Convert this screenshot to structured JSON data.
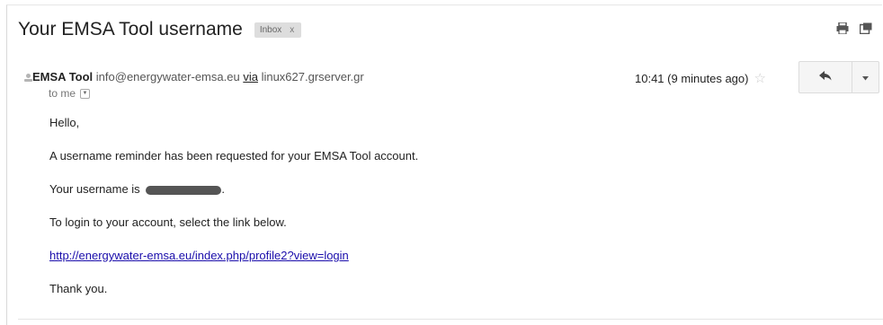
{
  "email": {
    "subject": "Your EMSA Tool username",
    "label": "Inbox",
    "label_close": "x",
    "sender_name": "EMSA Tool",
    "sender_email": "info@energywater-emsa.eu",
    "via_text": "via",
    "via_server": "linux627.grserver.gr",
    "to_text": "to me",
    "time": "10:41 (9 minutes ago)",
    "body": {
      "greeting": "Hello,",
      "line1": "A username reminder has been requested for your EMSA Tool account.",
      "username_prefix": "Your username is",
      "username_suffix": ".",
      "line3": "To login to your account, select the link below.",
      "link": "http://energywater-emsa.eu/index.php/profile2?view=login",
      "closing": "Thank you."
    }
  },
  "icons": {
    "print": "print-icon",
    "new_window": "new-window-icon",
    "avatar": "avatar-icon",
    "star": "star-icon",
    "reply": "reply-icon",
    "more": "chevron-down-icon",
    "to_dropdown": "dropdown-arrow-icon"
  }
}
